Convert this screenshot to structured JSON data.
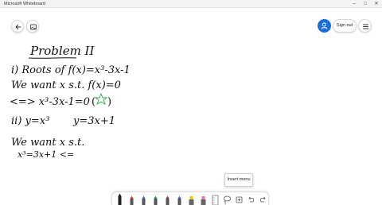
{
  "window": {
    "title": "Microsoft Whiteboard",
    "controls": {
      "minimize": "–",
      "maximize": "□",
      "close": "✕"
    }
  },
  "nav": {
    "back_icon": "back-arrow-icon",
    "gallery_icon": "sticker-gallery-icon"
  },
  "header": {
    "avatar_icon": "person-icon",
    "sign_out_label": "Sign out",
    "menu_icon": "hamburger-icon"
  },
  "board": {
    "lines": [
      "Problem II",
      "i) Roots of f(x)=x³-3x-1",
      "We want x s.t. f(x)=0",
      "<=> x³-3x-1=0",
      "ii) y=x³",
      "y=3x+1",
      "We want x s.t.",
      "x³=3x+1 <="
    ],
    "star_mark_color": "#2faa4a"
  },
  "tooltip": {
    "text": "Insert menu"
  },
  "toolbar": {
    "tools": [
      {
        "name": "pen-black",
        "color": "#222222"
      },
      {
        "name": "pen-red",
        "color": "#e0312b"
      },
      {
        "name": "pen-blue",
        "color": "#2a6fd6"
      },
      {
        "name": "pen-green",
        "color": "#1f9a4a"
      },
      {
        "name": "pen-dark-red",
        "color": "#c0242c"
      },
      {
        "name": "pen-blue-2",
        "color": "#3a67c9"
      },
      {
        "name": "highlighter-yellow",
        "color": "#f5c400"
      },
      {
        "name": "highlighter-pink",
        "color": "#e86fb0"
      },
      {
        "name": "ruler",
        "color": "#8a8a8a"
      },
      {
        "name": "lasso",
        "color": "#555555"
      },
      {
        "name": "insert",
        "color": "#555555"
      },
      {
        "name": "undo",
        "color": "#555555"
      },
      {
        "name": "redo",
        "color": "#555555"
      }
    ]
  },
  "colors": {
    "accent": "#1a6fd8",
    "ink": "#111111"
  }
}
